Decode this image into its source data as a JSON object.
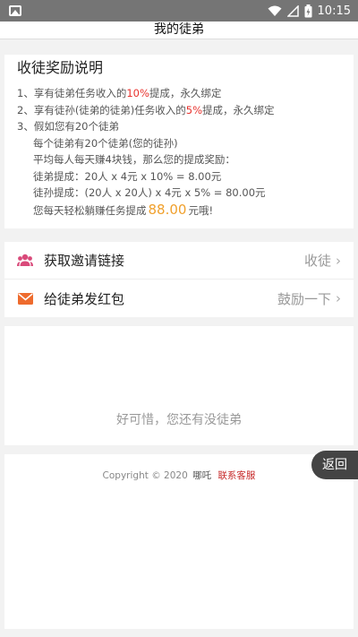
{
  "status_bar": {
    "time": "10:15",
    "icons": [
      "image-icon",
      "wifi-icon",
      "signal-icon",
      "battery-icon"
    ]
  },
  "header": {
    "title": "我的徒弟"
  },
  "intro": {
    "title": "收徒奖励说明",
    "line1": {
      "pre": "1、享有徒弟任务收入的",
      "pct": "10%",
      "post": "提成，永久绑定"
    },
    "line2": {
      "pre": "2、享有徒孙(徒弟的徒弟)任务收入的",
      "pct": "5%",
      "post": "提成，永久绑定"
    },
    "line3": "3、假如您有20个徒弟",
    "line4": "每个徒弟有20个徒弟(您的徒孙)",
    "line5": "平均每人每天赚4块钱，那么您的提成奖励：",
    "line6": "徒弟提成：20人 x 4元 x 10% = 8.00元",
    "line7": "徒孙提成：(20人 x 20人) x 4元 x 5% = 80.00元",
    "line8": {
      "pre": "您每天轻松躺赚任务提成",
      "amount": "88.00",
      "post": "元哦!"
    }
  },
  "actions": [
    {
      "label": "获取邀请链接",
      "right": "收徒",
      "icon": "users-icon"
    },
    {
      "label": "给徒弟发红包",
      "right": "鼓励一下",
      "icon": "envelope-icon"
    }
  ],
  "empty": {
    "text": "好可惜，您还有没徒弟"
  },
  "footer": {
    "copyright": "Copyright © 2020",
    "brand": "哪吒",
    "service": "联系客服"
  },
  "back": {
    "label": "返回"
  },
  "colors": {
    "accent_red": "#e8312c",
    "amount_orange": "#f0a02c",
    "users_icon": "#d94a7a",
    "envelope_icon": "#ee6b2d",
    "status_bar": "#757575"
  }
}
